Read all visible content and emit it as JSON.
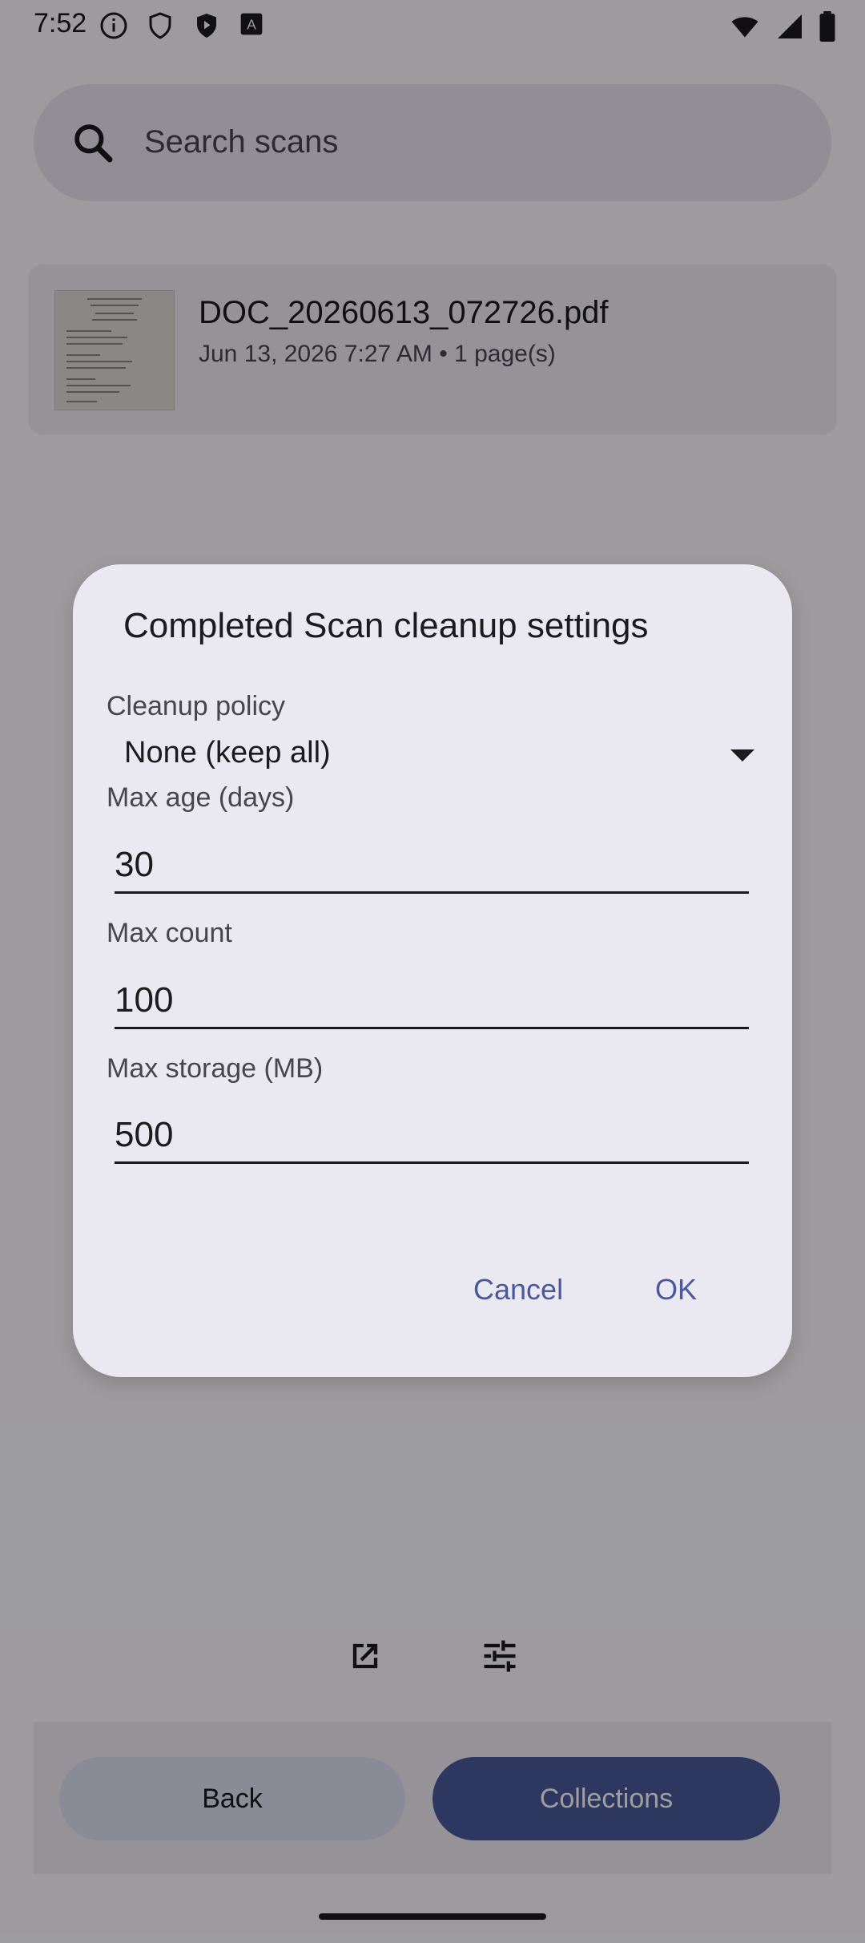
{
  "status_bar": {
    "time": "7:52",
    "icons_left": [
      "info-circle-icon",
      "shield-icon",
      "play-shield-icon",
      "font-a-icon"
    ],
    "icons_right": [
      "wifi-icon",
      "signal-icon",
      "battery-icon"
    ]
  },
  "search": {
    "placeholder": "Search scans"
  },
  "scan_item": {
    "title": "DOC_20260613_072726.pdf",
    "meta": "Jun 13, 2026 7:27 AM • 1 page(s)"
  },
  "dialog": {
    "title": "Completed Scan cleanup settings",
    "policy_label": "Cleanup policy",
    "policy_value": "None (keep all)",
    "max_age_label": "Max age (days)",
    "max_age_value": "30",
    "max_count_label": "Max count",
    "max_count_value": "100",
    "max_storage_label": "Max storage (MB)",
    "max_storage_value": "500",
    "cancel_label": "Cancel",
    "ok_label": "OK"
  },
  "bottom": {
    "back_label": "Back",
    "collections_label": "Collections"
  },
  "colors": {
    "primary": "#4a5999",
    "dialog_surface": "#eae8f1",
    "scrim": "rgba(0,0,0,0.38)"
  }
}
